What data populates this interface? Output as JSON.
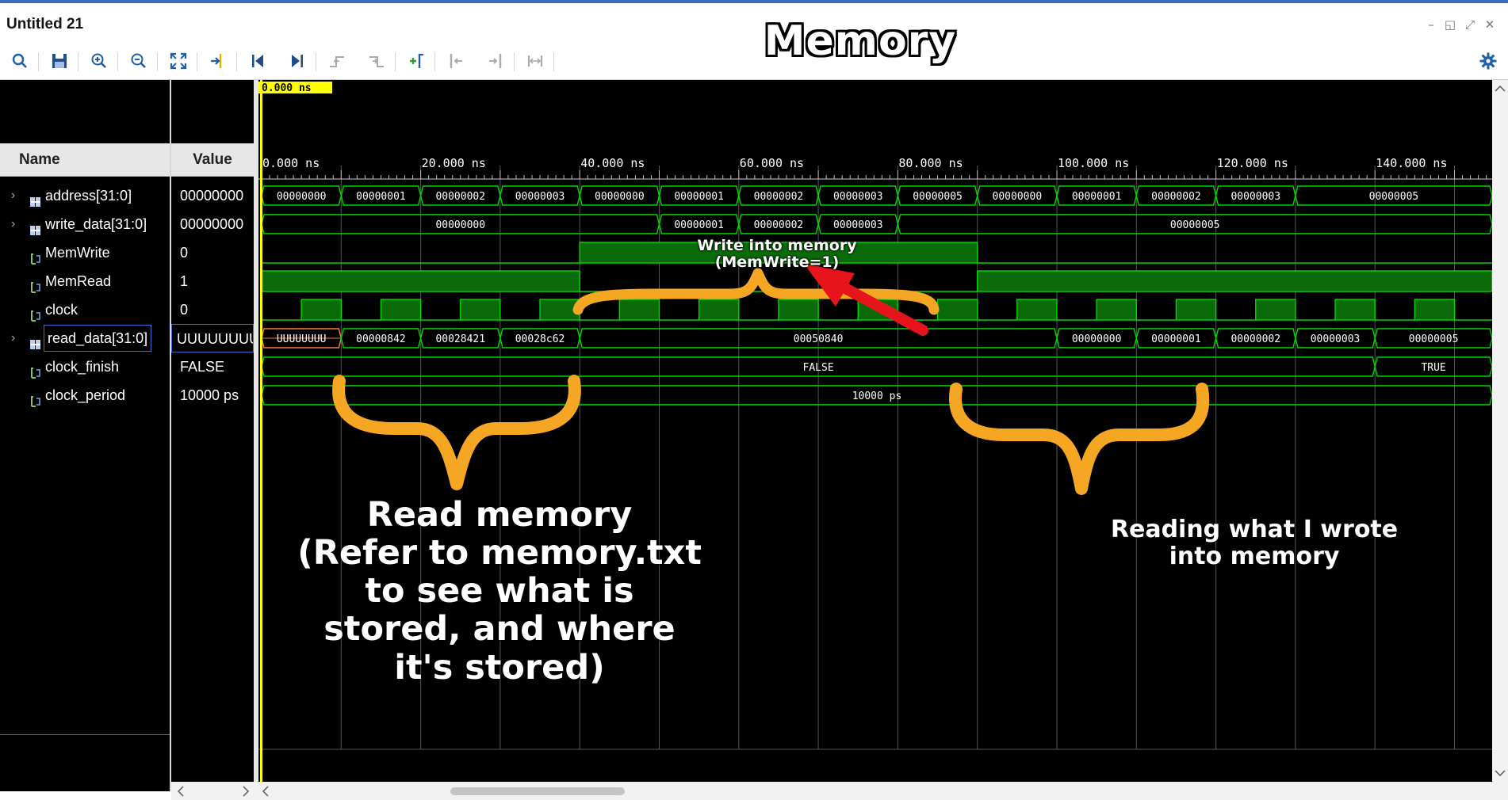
{
  "window": {
    "title": "Untitled 21",
    "minimize": "–",
    "restore": "◱",
    "maximize": "⤢",
    "close": "✕"
  },
  "toolbar": {
    "buttons": [
      "search-icon",
      "save-icon",
      "zoom-in-icon",
      "zoom-out-icon",
      "zoom-fit-icon",
      "go-to-cursor-icon",
      "go-to-time-zero-icon",
      "go-to-last-time-icon",
      "previous-transition-icon",
      "next-transition-icon",
      "add-marker-icon",
      "previous-marker-icon",
      "next-marker-icon",
      "swap-cursors-icon"
    ],
    "settings_icon": "gear-icon"
  },
  "cursor": {
    "time_label": "0.000 ns"
  },
  "columns": {
    "name_header": "Name",
    "value_header": "Value"
  },
  "signals": [
    {
      "name": "address[31:0]",
      "value": "00000000",
      "type": "bus",
      "expandable": true
    },
    {
      "name": "write_data[31:0]",
      "value": "00000000",
      "type": "bus",
      "expandable": true
    },
    {
      "name": "MemWrite",
      "value": "0",
      "type": "bit",
      "expandable": false
    },
    {
      "name": "MemRead",
      "value": "1",
      "type": "bit",
      "expandable": false
    },
    {
      "name": "clock",
      "value": "0",
      "type": "bit",
      "expandable": false
    },
    {
      "name": "read_data[31:0]",
      "value": "UUUUUUUU",
      "type": "bus",
      "expandable": true
    },
    {
      "name": "clock_finish",
      "value": "FALSE",
      "type": "bool",
      "expandable": false
    },
    {
      "name": "clock_period",
      "value": "10000 ps",
      "type": "param",
      "expandable": false
    }
  ],
  "timeline": {
    "unit": "ns",
    "labels": [
      "0.000 ns",
      "20.000 ns",
      "40.000 ns",
      "60.000 ns",
      "80.000 ns",
      "100.000 ns",
      "120.000 ns",
      "140.000 ns"
    ],
    "label_times": [
      0,
      20,
      40,
      60,
      80,
      100,
      120,
      140
    ],
    "range": [
      0,
      155
    ]
  },
  "waveforms": {
    "address": [
      {
        "start": 0,
        "end": 10,
        "value": "00000000"
      },
      {
        "start": 10,
        "end": 20,
        "value": "00000001"
      },
      {
        "start": 20,
        "end": 30,
        "value": "00000002"
      },
      {
        "start": 30,
        "end": 40,
        "value": "00000003"
      },
      {
        "start": 40,
        "end": 50,
        "value": "00000000"
      },
      {
        "start": 50,
        "end": 60,
        "value": "00000001"
      },
      {
        "start": 60,
        "end": 70,
        "value": "00000002"
      },
      {
        "start": 70,
        "end": 80,
        "value": "00000003"
      },
      {
        "start": 80,
        "end": 90,
        "value": "00000005"
      },
      {
        "start": 90,
        "end": 100,
        "value": "00000000"
      },
      {
        "start": 100,
        "end": 110,
        "value": "00000001"
      },
      {
        "start": 110,
        "end": 120,
        "value": "00000002"
      },
      {
        "start": 120,
        "end": 130,
        "value": "00000003"
      },
      {
        "start": 130,
        "end": 155,
        "value": "00000005"
      }
    ],
    "write_data": [
      {
        "start": 0,
        "end": 50,
        "value": "00000000"
      },
      {
        "start": 50,
        "end": 60,
        "value": "00000001"
      },
      {
        "start": 60,
        "end": 70,
        "value": "00000002"
      },
      {
        "start": 70,
        "end": 80,
        "value": "00000003"
      },
      {
        "start": 80,
        "end": 155,
        "value": "00000005"
      }
    ],
    "MemWrite": [
      {
        "start": 0,
        "end": 40,
        "level": 0
      },
      {
        "start": 40,
        "end": 90,
        "level": 1
      },
      {
        "start": 90,
        "end": 155,
        "level": 0
      }
    ],
    "MemRead": [
      {
        "start": 0,
        "end": 40,
        "level": 1
      },
      {
        "start": 40,
        "end": 90,
        "level": 0
      },
      {
        "start": 90,
        "end": 155,
        "level": 1
      }
    ],
    "clock": {
      "period": 10,
      "high_first": false,
      "start": 0,
      "end": 155
    },
    "read_data": [
      {
        "start": 0,
        "end": 10,
        "value": "UUUUUUUU",
        "undefined": true
      },
      {
        "start": 10,
        "end": 20,
        "value": "00000842"
      },
      {
        "start": 20,
        "end": 30,
        "value": "00028421"
      },
      {
        "start": 30,
        "end": 40,
        "value": "00028c62"
      },
      {
        "start": 40,
        "end": 100,
        "value": "00050840"
      },
      {
        "start": 100,
        "end": 110,
        "value": "00000000"
      },
      {
        "start": 110,
        "end": 120,
        "value": "00000001"
      },
      {
        "start": 120,
        "end": 130,
        "value": "00000002"
      },
      {
        "start": 130,
        "end": 140,
        "value": "00000003"
      },
      {
        "start": 140,
        "end": 155,
        "value": "00000005"
      }
    ],
    "clock_finish": [
      {
        "start": 0,
        "end": 140,
        "value": "FALSE"
      },
      {
        "start": 140,
        "end": 155,
        "value": "TRUE"
      }
    ],
    "clock_period": [
      {
        "start": 0,
        "end": 155,
        "value": "10000 ps"
      }
    ]
  },
  "annotations": {
    "title": "Memory",
    "write": "Write into memory\n(MemWrite=1)",
    "read": "Read memory\n(Refer to memory.txt\nto see what is\nstored, and where\nit's stored)",
    "read_back": "Reading what I wrote\ninto memory",
    "colors": {
      "brace": "#f5a623",
      "arrow": "#e8141b",
      "wave": "#00d800",
      "wave_fill": "#0b6b0b",
      "cursor": "#ffff00"
    }
  }
}
